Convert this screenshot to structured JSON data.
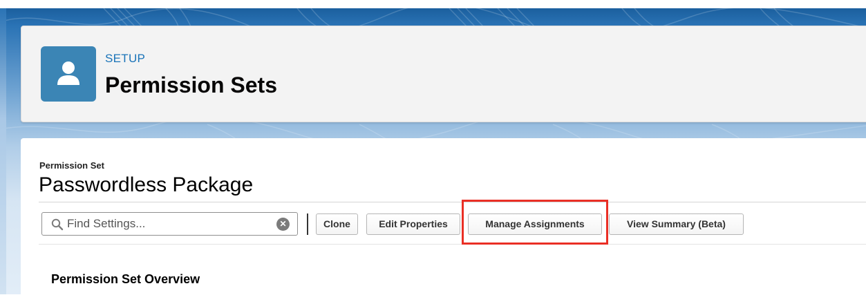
{
  "header": {
    "section_label": "SETUP",
    "title": "Permission Sets",
    "icon": "user-icon"
  },
  "record": {
    "type_label": "Permission Set",
    "name": "Passwordless Package"
  },
  "toolbar": {
    "search": {
      "placeholder": "Find Settings...",
      "value": "",
      "icon": "search-icon",
      "clear_icon": "clear-icon"
    },
    "buttons": {
      "clone": "Clone",
      "edit_properties": "Edit Properties",
      "manage_assignments": "Manage Assignments",
      "view_summary": "View Summary (Beta)"
    }
  },
  "overview": {
    "heading": "Permission Set Overview"
  },
  "colors": {
    "brand_blue": "#1b5f9e",
    "setup_label": "#1973b8",
    "icon_bg": "#3b85b5",
    "highlight": "#ea2f25"
  }
}
